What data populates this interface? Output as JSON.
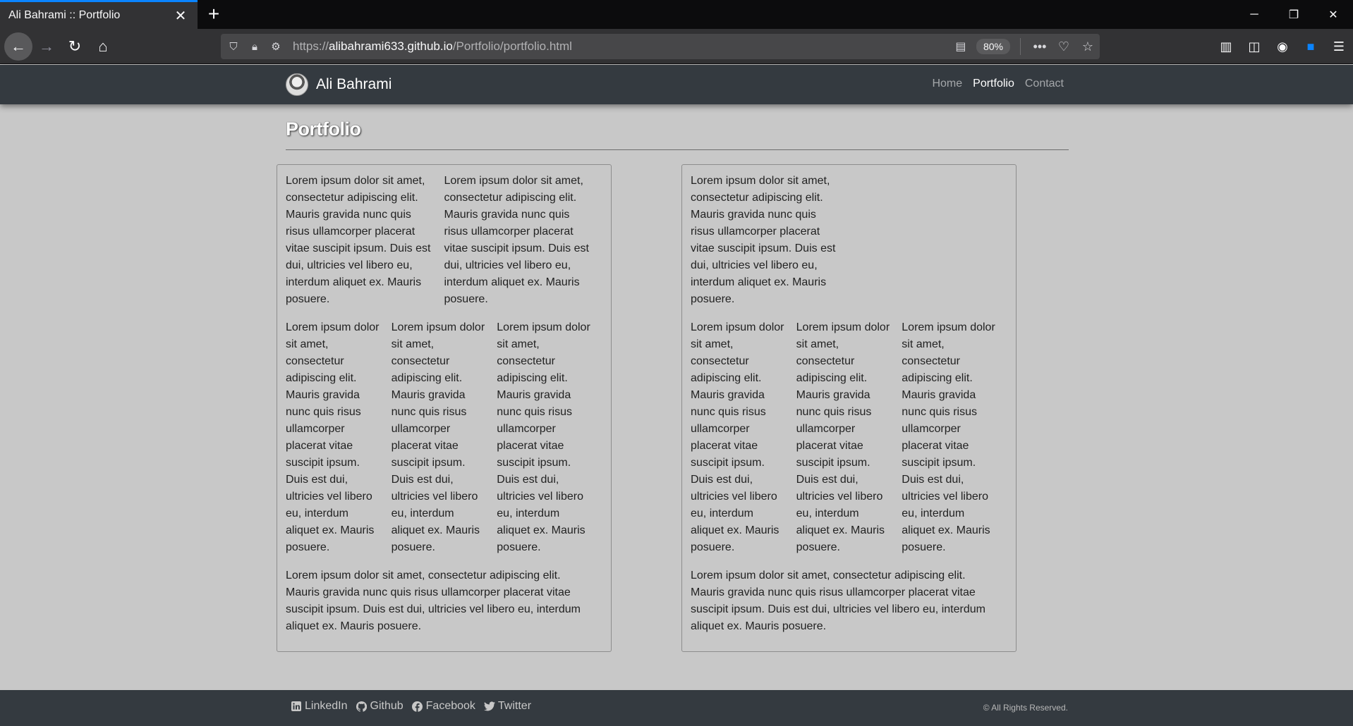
{
  "browser": {
    "tab_title": "Ali Bahrami :: Portfolio",
    "url_prefix": "https://",
    "url_host": "alibahrami633.github.io",
    "url_path": "/Portfolio/portfolio.html",
    "zoom": "80%"
  },
  "site": {
    "brand": "Ali Bahrami",
    "nav": [
      {
        "label": "Home"
      },
      {
        "label": "Portfolio"
      },
      {
        "label": "Contact"
      }
    ]
  },
  "page": {
    "title": "Portfolio",
    "lorem_long": "Lorem ipsum dolor sit amet, consectetur adipiscing elit. Mauris gravida nunc quis risus ullamcorper placerat vitae suscipit ipsum. Duis est dui, ultricies vel libero eu, interdum aliquet ex. Mauris posuere.",
    "left_card": {
      "row1": [
        "Lorem ipsum dolor sit amet, consectetur adipiscing elit. Mauris gravida nunc quis risus ullamcorper placerat vitae suscipit ipsum. Duis est dui, ultricies vel libero eu, interdum aliquet ex. Mauris posuere.",
        "Lorem ipsum dolor sit amet, consectetur adipiscing elit. Mauris gravida nunc quis risus ullamcorper placerat vitae suscipit ipsum. Duis est dui, ultricies vel libero eu, interdum aliquet ex. Mauris posuere."
      ],
      "row2": [
        "Lorem ipsum dolor sit amet, consectetur adipiscing elit. Mauris gravida nunc quis risus ullamcorper placerat vitae suscipit ipsum. Duis est dui, ultricies vel libero eu, interdum aliquet ex. Mauris posuere.",
        "Lorem ipsum dolor sit amet, consectetur adipiscing elit. Mauris gravida nunc quis risus ullamcorper placerat vitae suscipit ipsum. Duis est dui, ultricies vel libero eu, interdum aliquet ex. Mauris posuere.",
        "Lorem ipsum dolor sit amet, consectetur adipiscing elit. Mauris gravida nunc quis risus ullamcorper placerat vitae suscipit ipsum. Duis est dui, ultricies vel libero eu, interdum aliquet ex. Mauris posuere."
      ],
      "row3": "Lorem ipsum dolor sit amet, consectetur adipiscing elit. Mauris gravida nunc quis risus ullamcorper placerat vitae suscipit ipsum. Duis est dui, ultricies vel libero eu, interdum aliquet ex. Mauris posuere."
    },
    "right_card": {
      "row1": "Lorem ipsum dolor sit amet, consectetur adipiscing elit. Mauris gravida nunc quis risus ullamcorper placerat vitae suscipit ipsum. Duis est dui, ultricies vel libero eu, interdum aliquet ex. Mauris posuere.",
      "row2": [
        "Lorem ipsum dolor sit amet, consectetur adipiscing elit. Mauris gravida nunc quis risus ullamcorper placerat vitae suscipit ipsum. Duis est dui, ultricies vel libero eu, interdum aliquet ex. Mauris posuere.",
        "Lorem ipsum dolor sit amet, consectetur adipiscing elit. Mauris gravida nunc quis risus ullamcorper placerat vitae suscipit ipsum. Duis est dui, ultricies vel libero eu, interdum aliquet ex. Mauris posuere.",
        "Lorem ipsum dolor sit amet, consectetur adipiscing elit. Mauris gravida nunc quis risus ullamcorper placerat vitae suscipit ipsum. Duis est dui, ultricies vel libero eu, interdum aliquet ex. Mauris posuere."
      ],
      "row3": "Lorem ipsum dolor sit amet, consectetur adipiscing elit. Mauris gravida nunc quis risus ullamcorper placerat vitae suscipit ipsum. Duis est dui, ultricies vel libero eu, interdum aliquet ex. Mauris posuere."
    }
  },
  "footer": {
    "links": [
      {
        "label": "LinkedIn",
        "icon": "linkedin-icon"
      },
      {
        "label": "Github",
        "icon": "github-icon"
      },
      {
        "label": "Facebook",
        "icon": "facebook-icon"
      },
      {
        "label": "Twitter",
        "icon": "twitter-icon"
      }
    ],
    "copyright": "© All Rights Reserved."
  },
  "colors": {
    "accent": "#0a84ff",
    "header_bg": "#343a40",
    "page_bg": "#c8c8c8"
  }
}
